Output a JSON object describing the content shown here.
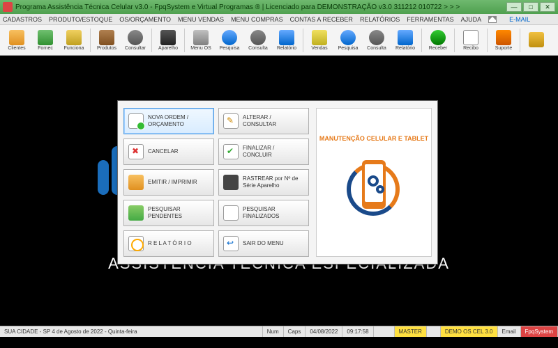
{
  "title": "Programa Assistência Técnica Celular v3.0 - FpqSystem e Virtual Programas ® | Licenciado para  DEMONSTRAÇÃO v3.0 311212 010722 > > >",
  "menubar": {
    "items": [
      "CADASTROS",
      "PRODUTO/ESTOQUE",
      "OS/ORÇAMENTO",
      "MENU VENDAS",
      "MENU COMPRAS",
      "CONTAS A RECEBER",
      "RELATÓRIOS",
      "FERRAMENTAS",
      "AJUDA"
    ],
    "email": "E-MAIL"
  },
  "toolbar": {
    "groups": [
      [
        {
          "name": "clientes",
          "label": "Clientes",
          "icon": "ico-clientes"
        },
        {
          "name": "fornec",
          "label": "Fornec",
          "icon": "ico-fornec"
        },
        {
          "name": "funciona",
          "label": "Funciona",
          "icon": "ico-func"
        }
      ],
      [
        {
          "name": "produtos",
          "label": "Produtos",
          "icon": "ico-prod"
        },
        {
          "name": "consultar",
          "label": "Consultar",
          "icon": "ico-cons"
        }
      ],
      [
        {
          "name": "aparelho",
          "label": "Aparelho",
          "icon": "ico-apar"
        }
      ],
      [
        {
          "name": "menuos",
          "label": "Menu OS",
          "icon": "ico-menuos"
        },
        {
          "name": "pesquisa-os",
          "label": "Pesquisa",
          "icon": "ico-pesq"
        },
        {
          "name": "consulta-os",
          "label": "Consulta",
          "icon": "ico-cons"
        },
        {
          "name": "relatorio-os",
          "label": "Relatório",
          "icon": "ico-rel"
        }
      ],
      [
        {
          "name": "vendas",
          "label": "Vendas",
          "icon": "ico-vendas"
        },
        {
          "name": "pesquisa-v",
          "label": "Pesquisa",
          "icon": "ico-pesq"
        },
        {
          "name": "consulta-v",
          "label": "Consulta",
          "icon": "ico-cons"
        },
        {
          "name": "relatorio-v",
          "label": "Relatório",
          "icon": "ico-rel"
        }
      ],
      [
        {
          "name": "receber",
          "label": "Receber",
          "icon": "ico-receber"
        }
      ],
      [
        {
          "name": "recibo",
          "label": "Recibo",
          "icon": "ico-recibo"
        }
      ],
      [
        {
          "name": "suporte",
          "label": "Suporte",
          "icon": "ico-sug"
        }
      ],
      [
        {
          "name": "sair",
          "label": "",
          "icon": "ico-exit"
        }
      ]
    ]
  },
  "background": {
    "tagline": "ASSISTENCIA TECNICA ESPECIALIZADA"
  },
  "dialog": {
    "col1": [
      {
        "name": "nova-ordem",
        "label": "NOVA ORDEM / ORÇAMENTO",
        "icon": "di-new",
        "selected": true
      },
      {
        "name": "cancelar",
        "label": "CANCELAR",
        "icon": "di-cancel"
      },
      {
        "name": "emitir",
        "label": "EMITIR  /  IMPRIMIR",
        "icon": "di-print"
      },
      {
        "name": "pesq-pendentes",
        "label": "PESQUISAR PENDENTES",
        "icon": "di-pend"
      },
      {
        "name": "relatorio",
        "label": "R E L A T Ó R I O",
        "icon": "di-report"
      }
    ],
    "col2": [
      {
        "name": "alterar",
        "label": "ALTERAR  /  CONSULTAR",
        "icon": "di-edit"
      },
      {
        "name": "finalizar",
        "label": "FINALIZAR  /  CONCLUIR",
        "icon": "di-final"
      },
      {
        "name": "rastrear",
        "label": "RASTREAR por Nº de Série Aparelho",
        "icon": "di-track"
      },
      {
        "name": "pesq-final",
        "label": "PESQUISAR FINALIZADOS",
        "icon": "di-search"
      },
      {
        "name": "sair-menu",
        "label": "SAIR DO MENU",
        "icon": "di-exit"
      }
    ],
    "brand": "MANUTENÇÃO CELULAR E TABLET"
  },
  "statusbar": {
    "city": "SUA CIDADE - SP  4 de Agosto de 2022 - Quinta-feira",
    "num": "Num",
    "caps": "Caps",
    "date": "04/08/2022",
    "time": "09:17:58",
    "master": "MASTER",
    "demo": "DEMO OS CEL 3.0",
    "email": "Email",
    "brand": "FpqSystem"
  }
}
